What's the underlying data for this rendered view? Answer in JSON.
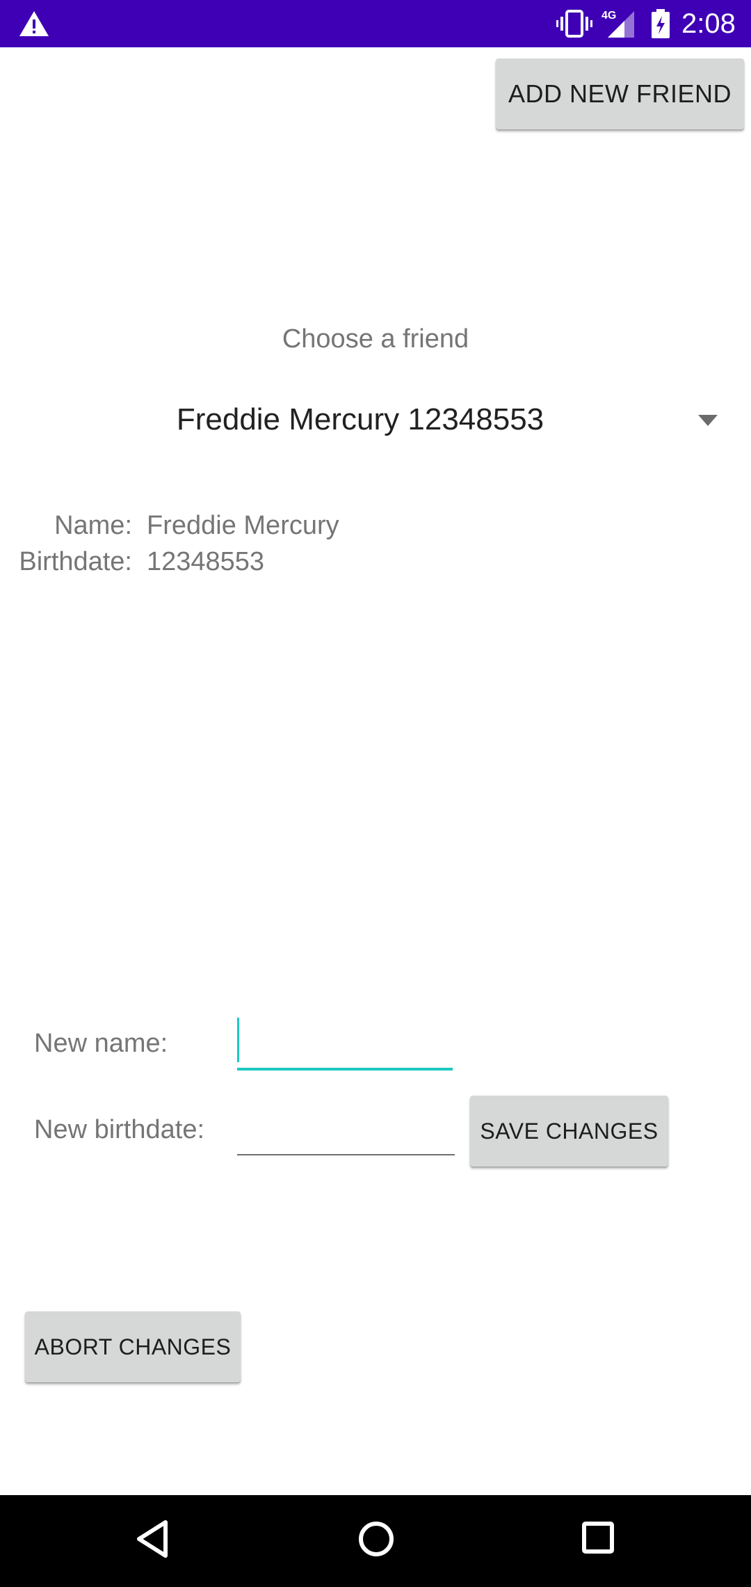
{
  "status_bar": {
    "time": "2:08",
    "network_label": "4G",
    "icons": [
      "warning-icon",
      "vibrate-icon",
      "signal-icon",
      "battery-charging-icon"
    ],
    "background": "#3f00b5"
  },
  "header": {
    "add_friend_label": "ADD NEW FRIEND"
  },
  "picker": {
    "prompt": "Choose a friend",
    "selected": "Freddie Mercury 12348553"
  },
  "details": {
    "name_label": "Name:",
    "name_value": "Freddie Mercury",
    "birthdate_label": "Birthdate:",
    "birthdate_value": "12348553"
  },
  "form": {
    "new_name_label": "New name:",
    "new_name_value": "",
    "new_birthdate_label": "New birthdate:",
    "new_birthdate_value": "",
    "save_label": "SAVE CHANGES",
    "abort_label": "ABORT CHANGES",
    "accent": "#1ec8c0"
  },
  "nav_bar": {
    "icons": [
      "back-icon",
      "home-icon",
      "recent-apps-icon"
    ]
  }
}
